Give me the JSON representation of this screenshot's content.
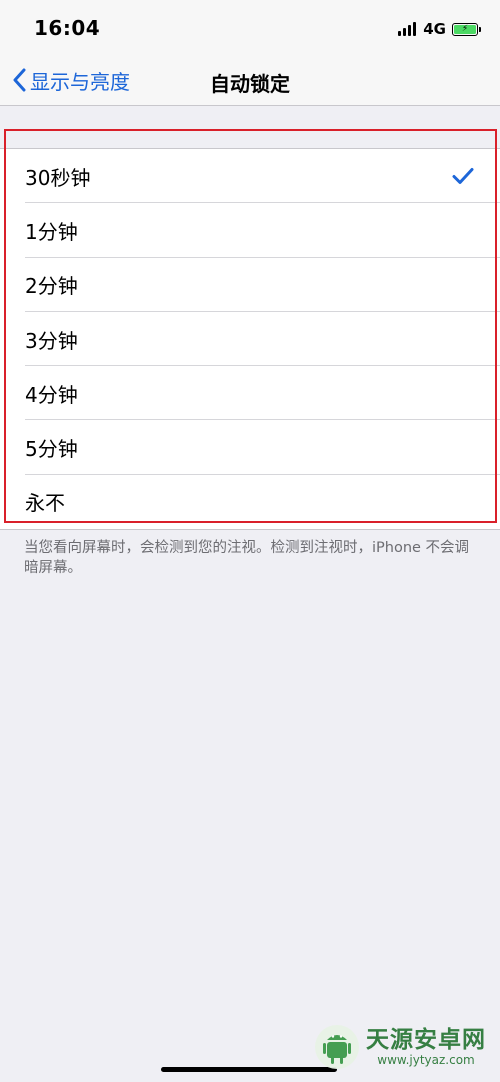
{
  "status_bar": {
    "time": "16:04",
    "network": "4G",
    "battery_symbol": "⚡"
  },
  "nav": {
    "back_label": "显示与亮度",
    "title": "自动锁定"
  },
  "options": [
    {
      "label": "30秒钟",
      "selected": true
    },
    {
      "label": "1分钟",
      "selected": false
    },
    {
      "label": "2分钟",
      "selected": false
    },
    {
      "label": "3分钟",
      "selected": false
    },
    {
      "label": "4分钟",
      "selected": false
    },
    {
      "label": "5分钟",
      "selected": false
    },
    {
      "label": "永不",
      "selected": false
    }
  ],
  "footer_note": "当您看向屏幕时，会检测到您的注视。检测到注视时，iPhone 不会调暗屏幕。",
  "watermark": {
    "title": "天源安卓网",
    "url": "www.jytyaz.com"
  },
  "colors": {
    "accent": "#1d66d8",
    "highlight": "#d9202a",
    "background": "#efeff4",
    "battery": "#4cd964"
  },
  "icons": {
    "back": "chevron-left-icon",
    "selected": "checkmark-icon",
    "signal": "cellular-signal-icon",
    "battery": "battery-charging-icon"
  }
}
